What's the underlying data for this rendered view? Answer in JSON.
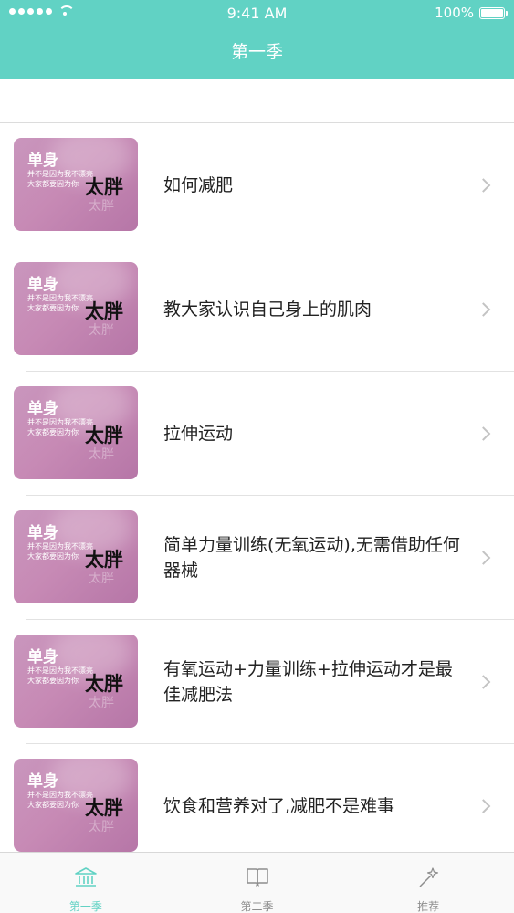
{
  "status_bar": {
    "time": "9:41 AM",
    "battery": "100%"
  },
  "nav": {
    "title": "第一季"
  },
  "thumbnail": {
    "line1": "单身",
    "line2a": "并不是因为我不漂亮",
    "line2b": "大家都要因为你",
    "line3": "太胖",
    "line4": "太胖"
  },
  "list": {
    "items": [
      {
        "title": "如何减肥"
      },
      {
        "title": "教大家认识自己身上的肌肉"
      },
      {
        "title": "拉伸运动"
      },
      {
        "title": "简单力量训练(无氧运动),无需借助任何器械"
      },
      {
        "title": "有氧运动+力量训练+拉伸运动才是最佳减肥法"
      },
      {
        "title": "饮食和营养对了,减肥不是难事"
      }
    ]
  },
  "tabbar": {
    "tabs": [
      {
        "label": "第一季",
        "icon": "library-icon",
        "active": true
      },
      {
        "label": "第二季",
        "icon": "open-book-icon",
        "active": false
      },
      {
        "label": "推荐",
        "icon": "magic-wand-icon",
        "active": false
      }
    ]
  },
  "colors": {
    "accent": "#61d2c4",
    "tab_inactive": "#8e8e8e",
    "thumbnail": "#c78ab5"
  }
}
